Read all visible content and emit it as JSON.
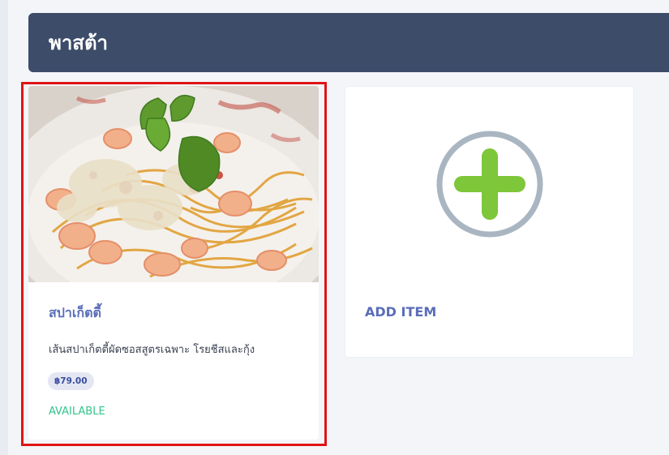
{
  "category": {
    "title": "พาสต้า"
  },
  "menu_item": {
    "name": "สปาเก็ตตี้",
    "description": "เส้นสปาเก็ตตี้ผัดซอสสูตรเฉพาะ โรยชีสและกุ้ง",
    "price": "฿79.00",
    "status": "AVAILABLE",
    "image_icon": "spaghetti-photo"
  },
  "add_item": {
    "label": "ADD ITEM",
    "icon": "plus-circle-icon"
  },
  "colors": {
    "header_bg": "#3c4c69",
    "accent_text": "#5a6db8",
    "available_green": "#34c48a",
    "plus_green": "#7ec63a",
    "ring_gray": "#a9b6c2",
    "selection_red": "#e01414"
  }
}
